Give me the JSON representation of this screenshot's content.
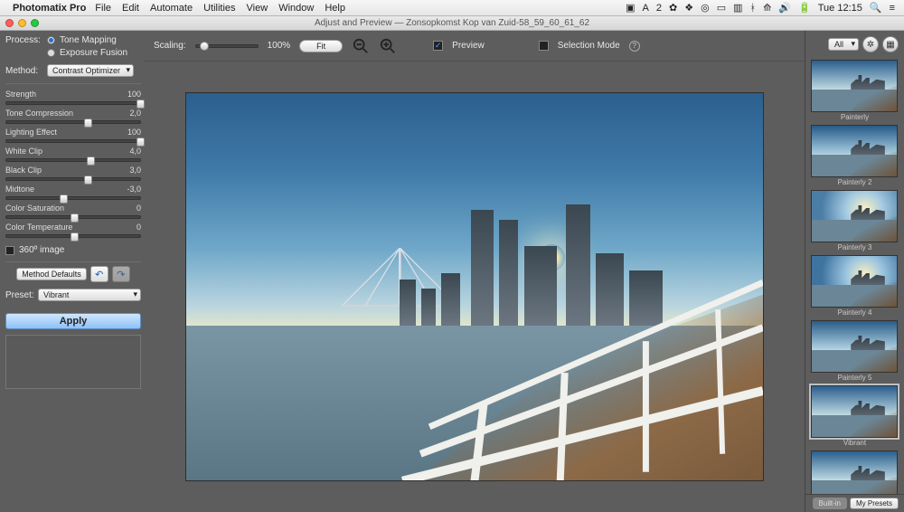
{
  "menubar": {
    "app_name": "Photomatix Pro",
    "items": [
      "File",
      "Edit",
      "Automate",
      "Utilities",
      "View",
      "Window",
      "Help"
    ],
    "clock": "Tue 12:15"
  },
  "titlebar": {
    "title": "Adjust and Preview — Zonsopkomst Kop van Zuid-58_59_60_61_62"
  },
  "left": {
    "process_label": "Process:",
    "process_options": {
      "tone_mapping": "Tone Mapping",
      "exposure_fusion": "Exposure Fusion"
    },
    "method_label": "Method:",
    "method_value": "Contrast Optimizer",
    "sliders": [
      {
        "name": "Strength",
        "value": "100",
        "pos": 97
      },
      {
        "name": "Tone Compression",
        "value": "2,0",
        "pos": 58
      },
      {
        "name": "Lighting Effect",
        "value": "100",
        "pos": 97
      },
      {
        "name": "White Clip",
        "value": "4,0",
        "pos": 60
      },
      {
        "name": "Black Clip",
        "value": "3,0",
        "pos": 58
      },
      {
        "name": "Midtone",
        "value": "-3,0",
        "pos": 40
      },
      {
        "name": "Color Saturation",
        "value": "0",
        "pos": 48
      },
      {
        "name": "Color Temperature",
        "value": "0",
        "pos": 48
      }
    ],
    "checkbox_360": "360º image",
    "method_defaults": "Method Defaults",
    "preset_label": "Preset:",
    "preset_value": "Vibrant",
    "apply": "Apply"
  },
  "top": {
    "scaling_label": "Scaling:",
    "scaling_value": "100%",
    "fit": "Fit",
    "preview": "Preview",
    "selection_mode": "Selection Mode"
  },
  "right": {
    "filter": "All",
    "presets": [
      "Painterly",
      "Painterly 2",
      "Painterly 3",
      "Painterly 4",
      "Painterly 5",
      "Vibrant",
      ""
    ],
    "selected_index": 5,
    "tab_builtin": "Built-in",
    "tab_mypresets": "My Presets"
  }
}
